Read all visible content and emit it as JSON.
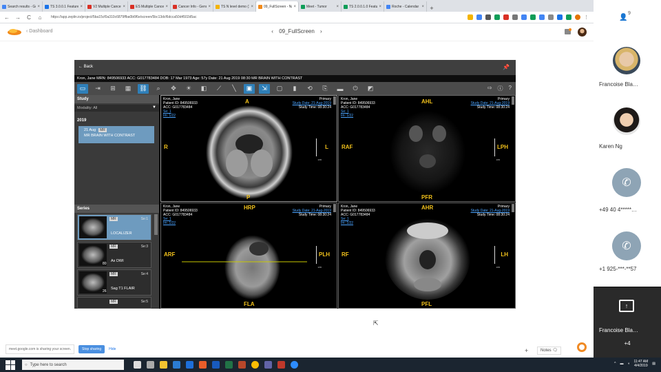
{
  "browser": {
    "tabs": [
      {
        "label": "Search results - Go",
        "color": "#4285f4"
      },
      {
        "label": "TS 3.0.0.1 Feature",
        "color": "#1a73e8"
      },
      {
        "label": "V2 Multiple Cancer",
        "color": "#d93025"
      },
      {
        "label": "ES Multiple Cancer",
        "color": "#d93025"
      },
      {
        "label": "Cancer Info - Genc",
        "color": "#d93025"
      },
      {
        "label": "TS N level demo (1",
        "color": "#f4b400"
      },
      {
        "label": "09_FullScreen - Na",
        "color": "#f28a1b",
        "active": true
      },
      {
        "label": "Meet - Tumor",
        "color": "#0f9d58"
      },
      {
        "label": "TS 2.0.0.1.0 Featur",
        "color": "#0f9d58"
      },
      {
        "label": "Roche - Calendar",
        "color": "#4285f4"
      }
    ],
    "new_tab": "+",
    "window_controls": {
      "minimize": "–",
      "maximize": "▢",
      "close": "✕"
    },
    "nav": {
      "back": "←",
      "forward": "→",
      "reload": "C",
      "home": "⌂"
    },
    "url": "https://app.zeplin.io/project/5ba15cf0a310c6879ffba0b6f6e/screen/5bc13dcf6dcca50d4502d5ac"
  },
  "app": {
    "back_link": "Dashboard",
    "screen_title": "09_FullScreen",
    "prev": "‹",
    "next": "›"
  },
  "viewer": {
    "back_label": "Back",
    "patient_bar": "Kron, Jane   MRN: 849506933   ACC: G017783484   DOB: 17 Mar 1973   Age: 57y   Date: 21 Aug 2019   08:30   MR BRAIN WITH CONTRAST",
    "study": {
      "header": "Study",
      "modality": "Modality: All",
      "year": "2019",
      "item_date": "21 Aug",
      "item_tag": "MR",
      "item_desc": "MR BRAIN WITH CONTRAST"
    },
    "series": {
      "header": "Series",
      "items": [
        {
          "tag": "MR",
          "ser": "Se:1",
          "name": "LOCALIZER",
          "num": ""
        },
        {
          "tag": "MR",
          "ser": "Se:3",
          "name": "Ax DWI",
          "num": "80"
        },
        {
          "tag": "MR",
          "ser": "Se:4",
          "name": "Sag T1 FLAIR",
          "num": "26"
        },
        {
          "tag": "MR",
          "ser": "Se:5",
          "name": "",
          "num": ""
        }
      ]
    },
    "viewports": [
      {
        "name": "Kron, Jane",
        "pid": "Patient ID: 849506933",
        "acc": "ACC: G017783484",
        "se": "Se: 1",
        "im": "Im: 1/22",
        "primary": "Primary",
        "study_date": "Study Date: 21-Aug-2019",
        "study_time": "Study Time: 08:30:24",
        "top": "A",
        "left": "R",
        "right": "L",
        "bottom": "P",
        "cm": "cm"
      },
      {
        "name": "Kron, Jane",
        "pid": "Patient ID: 849506933",
        "acc": "ACC: G017783484",
        "se": "Se: 1",
        "im": "Im: 1/22",
        "primary": "Primary",
        "study_date": "Study Date: 21-Aug-2019",
        "study_time": "Study Time: 08:30:24",
        "top": "AHL",
        "left": "RAF",
        "right": "LPH",
        "bottom": "PFR",
        "cm": "cm"
      },
      {
        "name": "Kron, Jane",
        "pid": "Patient ID: 849506933",
        "acc": "ACC: G017783484",
        "se": "Se: 1",
        "im": "Im: 1/22",
        "primary": "Primary",
        "study_date": "Study Date: 21-Aug-2019",
        "study_time": "Study Time: 08:30:24",
        "top": "HRP",
        "left": "ARF",
        "right": "PLH",
        "bottom": "FLA",
        "cm": "cm"
      },
      {
        "name": "Kron, Jane",
        "pid": "Patient ID: 849506933",
        "acc": "ACC: G017783484",
        "se": "Se: 1",
        "im": "Im: 1/22",
        "primary": "Primary",
        "study_date": "Study Date: 21-Aug-2019",
        "study_time": "Study Time: 08:30:24",
        "top": "AHR",
        "left": "RF",
        "right": "LH",
        "bottom": "PFL",
        "cm": "cm"
      }
    ]
  },
  "share": {
    "message": "meet.google.com is sharing your screen.",
    "stop": "Stop sharing",
    "hide": "Hide"
  },
  "notes": {
    "plus": "+",
    "label": "Notes"
  },
  "taskbar": {
    "search_placeholder": "Type here to search",
    "time": "11:47 AM",
    "date": "4/4/2019"
  },
  "meet": {
    "participant_count": "9",
    "participants": [
      {
        "name": "Francoise Bla…"
      },
      {
        "name": "Karen Ng"
      },
      {
        "name": "+49 40 4*****…"
      },
      {
        "name": "+1 925-***-**57"
      }
    ],
    "presenter": "Francoise Bla…",
    "more": "+4"
  },
  "colors": {
    "accent": "#2f7fb8",
    "orientation": "#f3c21b",
    "link": "#4aa3ff",
    "brand_orange": "#f28a1b"
  }
}
